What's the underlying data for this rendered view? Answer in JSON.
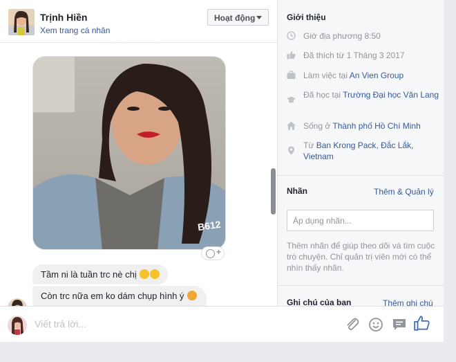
{
  "header": {
    "name": "Trịnh Hiền",
    "profile_link": "Xem trang cá nhân",
    "status_button": "Hoạt động"
  },
  "photo": {
    "watermark": "B612"
  },
  "messages": [
    {
      "text": "Tầm ni là tuần trc nè chị",
      "emoji": [
        "grin-icon",
        "grin-icon"
      ]
    },
    {
      "text": "Còn trc nữa em ko dám chụp hình ý",
      "emoji": [
        "sad-icon"
      ]
    }
  ],
  "intro": {
    "title": "Giới thiệu",
    "rows": [
      {
        "icon": "clock-icon",
        "text": "Giờ địa phương 8:50",
        "link": ""
      },
      {
        "icon": "like-icon",
        "text": "Đã thích từ 1 Tháng 3 2017",
        "link": ""
      },
      {
        "icon": "briefcase-icon",
        "text": "Làm việc tại ",
        "link": "An Vien Group"
      },
      {
        "icon": "graduation-icon",
        "text": "Đã học tại ",
        "link": "Trường Đại học Văn Lang"
      },
      {
        "icon": "home-icon",
        "text": "Sống ở ",
        "link": "Thành phố Hồ Chí Minh"
      },
      {
        "icon": "location-pin-icon",
        "text": "Từ ",
        "link": "Ban Krong Pack, Đắc Lắk, Vietnam"
      }
    ]
  },
  "labels": {
    "title": "Nhãn",
    "manage": "Thêm & Quản lý",
    "input_placeholder": "Áp dụng nhãn...",
    "help": "Thêm nhãn để giúp theo dõi và tìm cuộc trò chuyện. Chỉ quản trị viên mới có thể nhìn thấy nhãn."
  },
  "notes": {
    "title": "Ghi chú của bạn",
    "add": "Thêm ghi chú"
  },
  "reply": {
    "placeholder": "Viết trả lời...",
    "tools": [
      "attachment-icon",
      "emoji-icon",
      "saved-reply-icon",
      "thumbs-up-icon"
    ]
  },
  "colors": {
    "link": "#365899",
    "accent": "#4267b2",
    "muted": "#90949c"
  }
}
